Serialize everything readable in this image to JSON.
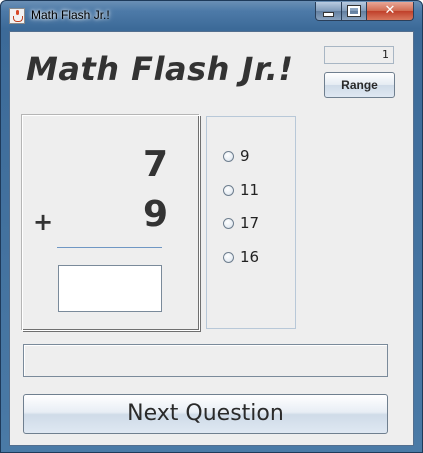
{
  "window": {
    "title": "Math Flash Jr.!",
    "controls": {
      "minimize": "minimize-icon",
      "maximize": "maximize-icon",
      "close": "close-icon",
      "close_glyph": "✕"
    }
  },
  "app": {
    "heading": "Math Flash Jr.!",
    "range_value": "1",
    "range_button": "Range"
  },
  "problem": {
    "top_number": "7",
    "operator": "+",
    "bottom_number": "9",
    "answer_value": ""
  },
  "choices": [
    {
      "label": "9",
      "selected": false
    },
    {
      "label": "11",
      "selected": false
    },
    {
      "label": "17",
      "selected": false
    },
    {
      "label": "16",
      "selected": false
    }
  ],
  "feedback": {
    "text": ""
  },
  "next_button": "Next Question",
  "colors": {
    "titlebar": "#4d7aa8",
    "panel": "#eeeeee",
    "text": "#333333"
  }
}
